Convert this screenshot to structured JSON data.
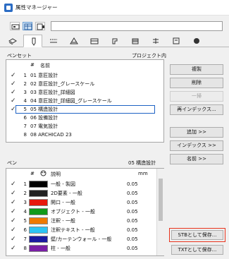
{
  "window": {
    "title": "属性マネージャー"
  },
  "toolbar": {
    "buttons": [
      "open-icon",
      "table-icon",
      "attribute-icon"
    ],
    "name_value": ""
  },
  "tabs": [
    "layers-icon",
    "pens-icon",
    "lines-icon",
    "fills-icon",
    "composites-icon",
    "profiles-icon",
    "surfaces-icon",
    "zones-icon",
    "markup-icon"
  ],
  "penset_section": {
    "label": "ペンセット",
    "right_label": "プロジェクト内",
    "col_num": "#",
    "col_name": "名前",
    "rows": [
      {
        "check": "✓",
        "num": "1",
        "name": "01 意匠設計"
      },
      {
        "check": "✓",
        "num": "2",
        "name": "02 意匠設計_グレースケール"
      },
      {
        "check": "✓",
        "num": "3",
        "name": "03 意匠設計_詳細図"
      },
      {
        "check": "✓",
        "num": "4",
        "name": "04 意匠設計_詳細図_グレースケール"
      },
      {
        "check": "✓",
        "num": "5",
        "name": "05 構造設計",
        "selected": true
      },
      {
        "check": "",
        "num": "6",
        "name": "06 設備設計"
      },
      {
        "check": "",
        "num": "7",
        "name": "07 電気設計"
      },
      {
        "check": "",
        "num": "8",
        "name": "08 ARCHICAD 23"
      }
    ]
  },
  "buttons_right": {
    "copy": "複製",
    "delete": "削除",
    "replace": "一掃",
    "reindex": "再インデックス...",
    "append": "追加 >>",
    "index": "インデックス >>",
    "name": "名前 >>",
    "save_stb": "STBとして保存...",
    "save_txt": "TXTとして保存..."
  },
  "pen_section": {
    "label": "ペン",
    "right_label": "05 構造設計",
    "col_num": "#",
    "col_desc": "説明",
    "col_mm": "mm",
    "rows": [
      {
        "check": "✓",
        "num": "1",
        "color": "#000000",
        "desc": "一般 - 製図",
        "mm": "0.05"
      },
      {
        "check": "✓",
        "num": "2",
        "color": "#222222",
        "desc": "2D要素 - 一般",
        "mm": "0.05"
      },
      {
        "check": "✓",
        "num": "3",
        "color": "#e8180c",
        "desc": "開口 - 一般",
        "mm": "0.05"
      },
      {
        "check": "✓",
        "num": "4",
        "color": "#119a1a",
        "desc": "オブジェクト - 一般",
        "mm": "0.05"
      },
      {
        "check": "✓",
        "num": "5",
        "color": "#f07a00",
        "desc": "注釈 - 一般",
        "mm": "0.05"
      },
      {
        "check": "✓",
        "num": "6",
        "color": "#2dc4f4",
        "desc": "注釈テキスト - 一般",
        "mm": "0.05"
      },
      {
        "check": "✓",
        "num": "7",
        "color": "#1a1aa0",
        "desc": "壁/カーテンウォール - 一般",
        "mm": "0.05"
      },
      {
        "check": "✓",
        "num": "8",
        "color": "#7a1fa6",
        "desc": "柱 - 一般",
        "mm": "0.05"
      }
    ]
  }
}
